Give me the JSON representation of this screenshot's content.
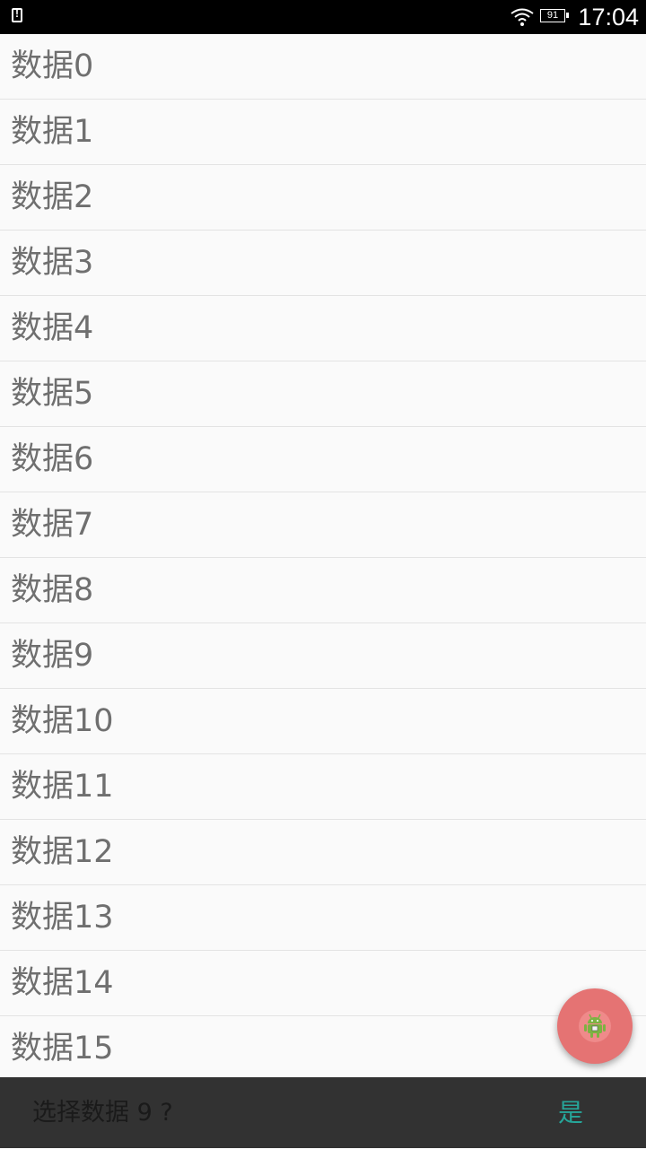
{
  "status_bar": {
    "battery": "91",
    "time": "17:04"
  },
  "list": {
    "items": [
      "数据0",
      "数据1",
      "数据2",
      "数据3",
      "数据4",
      "数据5",
      "数据6",
      "数据7",
      "数据8",
      "数据9",
      "数据10",
      "数据11",
      "数据12",
      "数据13",
      "数据14",
      "数据15"
    ]
  },
  "fab": {
    "icon": "android-icon"
  },
  "snackbar": {
    "message": "选择数据 9 ?",
    "action": "是"
  },
  "colors": {
    "fab": "#e57373",
    "snackbar_bg": "#323232",
    "snackbar_action": "#26a69a"
  }
}
